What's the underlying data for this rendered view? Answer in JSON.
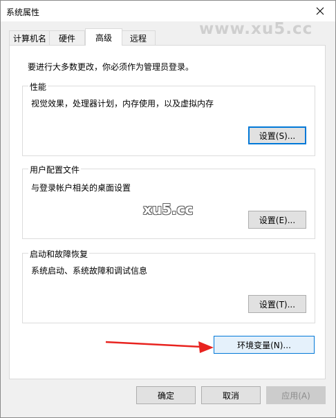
{
  "window": {
    "title": "系统属性"
  },
  "watermark": {
    "top": "www.xu5.cc",
    "middle": "xu5.cc"
  },
  "tabs": [
    {
      "label": "计算机名"
    },
    {
      "label": "硬件"
    },
    {
      "label": "高级",
      "active": true
    },
    {
      "label": "远程"
    }
  ],
  "intro": "要进行大多数更改，你必须作为管理员登录。",
  "groups": {
    "performance": {
      "title": "性能",
      "desc": "视觉效果，处理器计划，内存使用，以及虚拟内存",
      "button": "设置(S)..."
    },
    "profiles": {
      "title": "用户配置文件",
      "desc": "与登录帐户相关的桌面设置",
      "button": "设置(E)..."
    },
    "startup": {
      "title": "启动和故障恢复",
      "desc": "系统启动、系统故障和调试信息",
      "button": "设置(T)..."
    }
  },
  "env_button": "环境变量(N)...",
  "footer": {
    "ok": "确定",
    "cancel": "取消",
    "apply": "应用(A)"
  },
  "colors": {
    "accent": "#0078d7",
    "arrow": "#e8231f"
  }
}
